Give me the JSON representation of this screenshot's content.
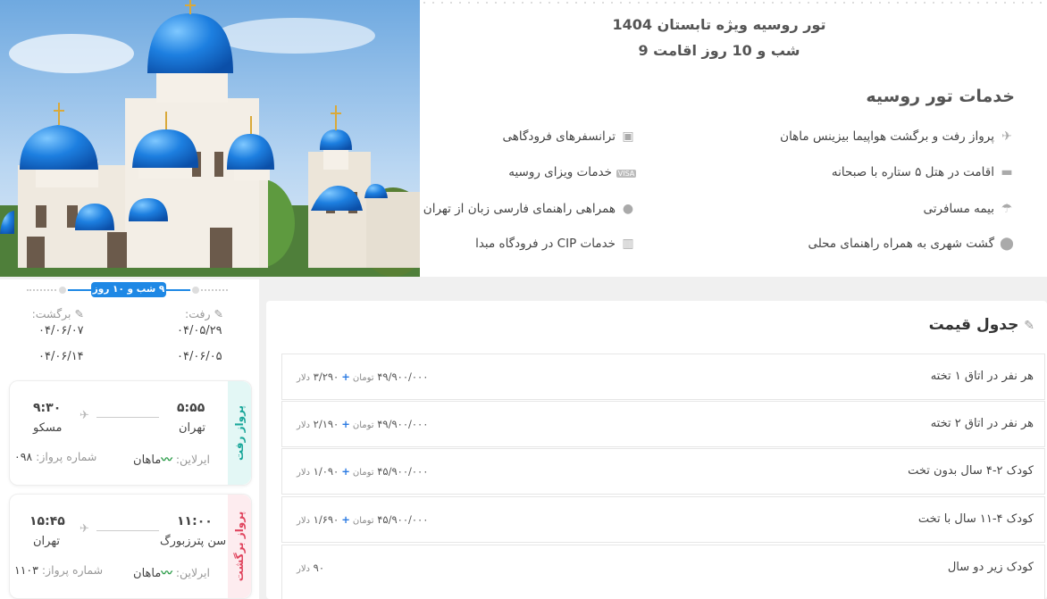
{
  "tour": {
    "title": "تور روسیه ویژه تابستان 1404",
    "duration": "9 شب و 10 روز اقامت"
  },
  "services": {
    "heading": "خدمات تور روسیه",
    "items": [
      {
        "label": "پرواز رفت و برگشت هواپیما بیزینس ماهان",
        "icon": "airplane-icon"
      },
      {
        "label": "ترانسفرهای فرودگاهی",
        "icon": "bus-icon"
      },
      {
        "label": "اقامت در هتل ۵ ستاره با صبحانه",
        "icon": "bed-icon"
      },
      {
        "label": "خدمات ویزای روسیه",
        "icon": "visa-card-icon"
      },
      {
        "label": "بیمه مسافرتی",
        "icon": "umbrella-icon"
      },
      {
        "label": "همراهی راهنمای فارسی زبان از تهران",
        "icon": "user-icon"
      },
      {
        "label": "گشت شهری به همراه راهنمای محلی",
        "icon": "map-pin-icon"
      },
      {
        "label": "خدمات CIP در فرودگاه مبدا",
        "icon": "building-icon"
      }
    ]
  },
  "dates": {
    "badge": "۹ شب و ۱۰ روز",
    "depart_label": "رفت:",
    "return_label": "برگشت:",
    "depart_dates": [
      "۰۴/۰۵/۲۹",
      "۰۴/۰۶/۰۵"
    ],
    "return_dates": [
      "۰۴/۰۶/۰۷",
      "۰۴/۰۶/۱۴"
    ]
  },
  "flights": {
    "outbound": {
      "tab": "پرواز رفت",
      "dep_time": "۵:۵۵",
      "dep_city": "تهران",
      "arr_time": "۹:۳۰",
      "arr_city": "مسکو",
      "airline_label": "ایرلاین:",
      "airline": "ماهان",
      "flight_no_label": "شماره پرواز:",
      "flight_no": "۰۹۸"
    },
    "inbound": {
      "tab": "پرواز برگشت",
      "dep_time": "۱۱:۰۰",
      "dep_city": "سن پترزبورگ",
      "arr_time": "۱۵:۴۵",
      "arr_city": "تهران",
      "airline_label": "ایرلاین:",
      "airline": "ماهان",
      "flight_no_label": "شماره پرواز:",
      "flight_no": "۱۱۰۳"
    }
  },
  "prices": {
    "heading": "جدول قیمت",
    "toman": "تومان",
    "plus": "+",
    "dollar": "دلار",
    "rows": [
      {
        "label": "هر نفر در اتاق ۱ تخته",
        "toman": "۴۹/۹۰۰/۰۰۰",
        "usd": "۳/۲۹۰"
      },
      {
        "label": "هر نفر در اتاق ۲ تخته",
        "toman": "۴۹/۹۰۰/۰۰۰",
        "usd": "۲/۱۹۰"
      },
      {
        "label": "کودک ۲-۴ سال بدون تخت",
        "toman": "۴۵/۹۰۰/۰۰۰",
        "usd": "۱/۰۹۰"
      },
      {
        "label": "کودک ۴-۱۱ سال با تخت",
        "toman": "۴۵/۹۰۰/۰۰۰",
        "usd": "۱/۶۹۰"
      },
      {
        "label": "کودک زیر دو سال",
        "toman": "",
        "usd": "۹۰"
      }
    ]
  },
  "colors": {
    "accent_blue": "#1e88e5",
    "outbound_tab": "#e3f7f5",
    "outbound_text": "#1aa79a",
    "inbound_tab": "#fdecef",
    "inbound_text": "#e0455e",
    "mahan_green": "#2e9d4b"
  }
}
